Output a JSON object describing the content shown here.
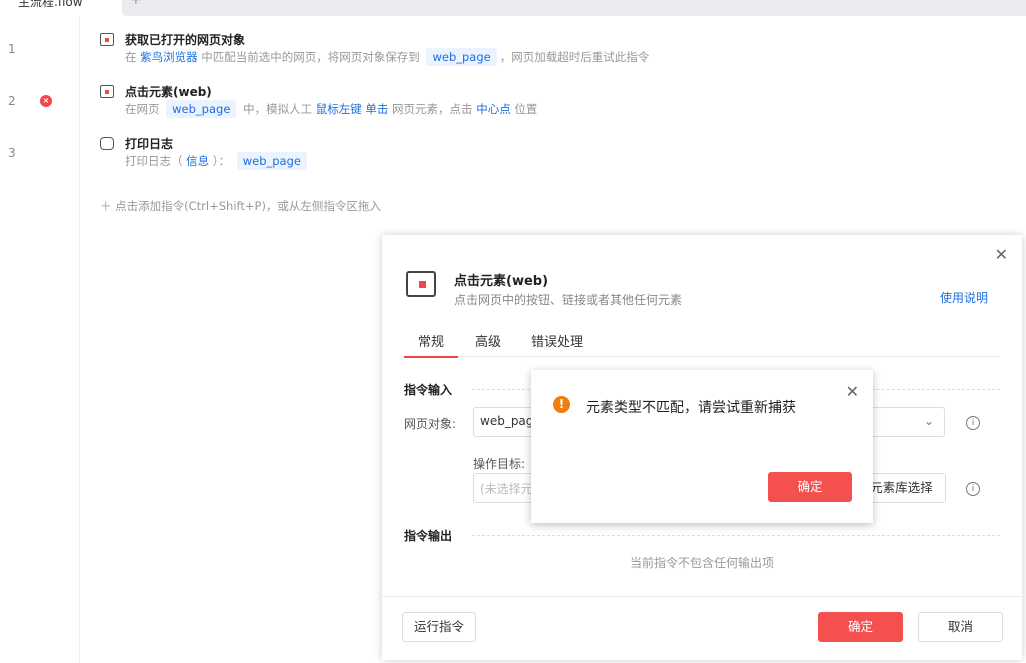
{
  "tab": {
    "label": "主流程.flow",
    "add": "+"
  },
  "lines": [
    "1",
    "2",
    "3"
  ],
  "steps": [
    {
      "title": "获取已打开的网页对象",
      "d": [
        "在 ",
        "紫鸟浏览器",
        " 中匹配当前选中的网页，将网页对象保存到 ",
        "web_page",
        "，网页加载超时后重试此指令"
      ]
    },
    {
      "title": "点击元素(web)",
      "d": [
        "在网页 ",
        "web_page",
        " 中，模拟人工 ",
        "鼠标左键",
        " ",
        "单击",
        " 网页元素，点击 ",
        "中心点",
        " 位置"
      ]
    },
    {
      "title": "打印日志",
      "d": [
        "打印日志（ ",
        "信息",
        " ）： ",
        "web_page"
      ]
    }
  ],
  "add_hint": "＋  点击添加指令(Ctrl+Shift+P)，或从左侧指令区拖入",
  "panel": {
    "title": "点击元素(web)",
    "subtitle": "点击网页中的按钮、链接或者其他任何元素",
    "help": "使用说明",
    "tabs": [
      "常规",
      "高级",
      "错误处理"
    ],
    "input_section": "指令输入",
    "page_label": "网页对象:",
    "page_value": "web_page",
    "target_label": "操作目标:",
    "target_placeholder": "(未选择元素)",
    "lib_button": "元素库选择",
    "output_section": "指令输出",
    "no_output": "当前指令不包含任何输出项",
    "run": "运行指令",
    "ok": "确定",
    "cancel": "取消"
  },
  "alert": {
    "message": "元素类型不匹配，请尝试重新捕获",
    "ok": "确定"
  }
}
